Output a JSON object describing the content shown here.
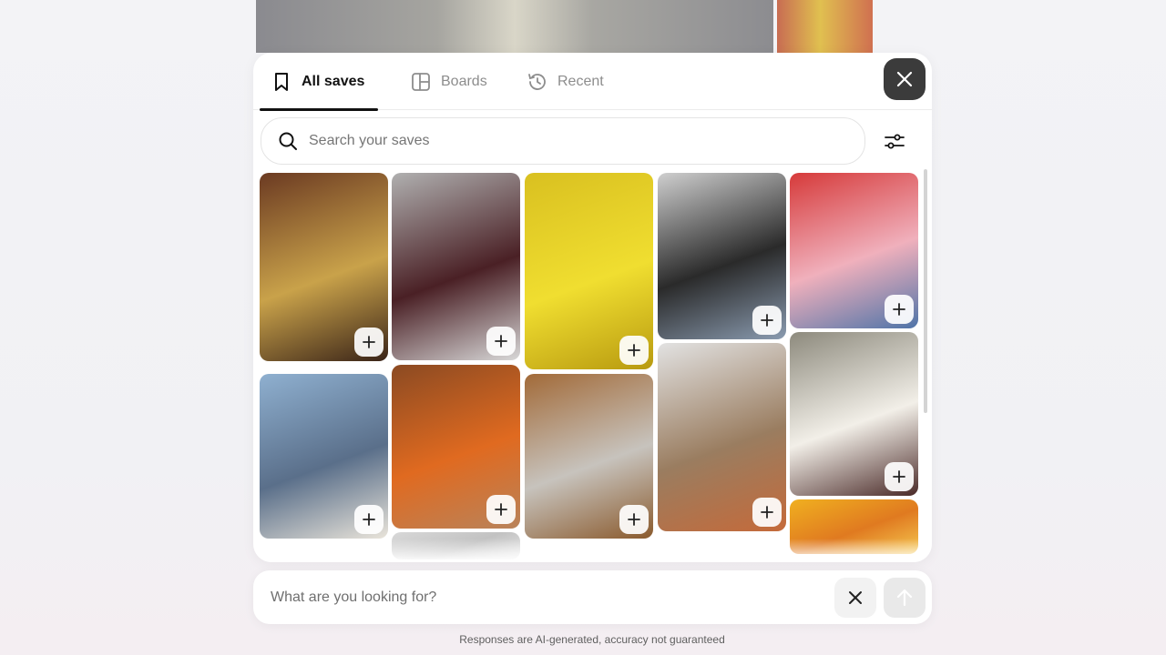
{
  "tabs": [
    {
      "label": "All saves",
      "icon": "bookmark-icon",
      "active": true
    },
    {
      "label": "Boards",
      "icon": "boards-icon",
      "active": false
    },
    {
      "label": "Recent",
      "icon": "history-icon",
      "active": false
    }
  ],
  "search": {
    "placeholder": "Search your saves",
    "value": ""
  },
  "ask": {
    "placeholder": "What are you looking for?",
    "value": ""
  },
  "disclaimer": "Responses are AI-generated, accuracy not guaranteed",
  "pins": [
    {
      "subject": "yellow-suede-boots",
      "colors": [
        "#6b3a22",
        "#c9a24a",
        "#3a2418"
      ]
    },
    {
      "subject": "woman-dark-suit",
      "colors": [
        "#b0b0b0",
        "#4a2025",
        "#d8d8d8"
      ]
    },
    {
      "subject": "yellow-chairs",
      "colors": [
        "#d9c020",
        "#f0de30",
        "#b89a10"
      ]
    },
    {
      "subject": "person-black-jacket",
      "colors": [
        "#cfcfcf",
        "#2a2a2a",
        "#8a9bb0"
      ]
    },
    {
      "subject": "cherry-cake",
      "colors": [
        "#d63a3a",
        "#f0b0bc",
        "#4f74a8"
      ]
    },
    {
      "subject": "denim-outfit",
      "colors": [
        "#8fb0d0",
        "#5a6f8a",
        "#e9e4da"
      ]
    },
    {
      "subject": "orange-camera-bag",
      "colors": [
        "#8b4a22",
        "#e06a20",
        "#b9835a"
      ]
    },
    {
      "subject": "grey-coat-wood-wall",
      "colors": [
        "#a26a38",
        "#c7c3bd",
        "#8a5a2d"
      ]
    },
    {
      "subject": "chrome-chair-pose",
      "colors": [
        "#e2e2e2",
        "#9a7d60",
        "#c56a3a"
      ]
    },
    {
      "subject": "mesh-flats",
      "colors": [
        "#8d8a7d",
        "#f2efe8",
        "#4a2a28"
      ]
    },
    {
      "subject": "partial-grey-image",
      "colors": [
        "#d8d8d8",
        "#c2c2c2",
        "#e8e8e8"
      ]
    },
    {
      "subject": "yellow-shoes-partial",
      "colors": [
        "#f0b020",
        "#e07a20",
        "#f5c850"
      ]
    }
  ]
}
